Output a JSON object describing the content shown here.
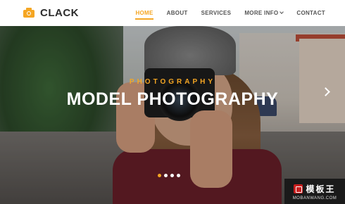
{
  "header": {
    "logo_text": "CLACK",
    "logo_icon": "camera-icon",
    "accent_color": "#f5a623",
    "nav": [
      {
        "label": "HOME",
        "active": true
      },
      {
        "label": "ABOUT",
        "active": false
      },
      {
        "label": "SERVICES",
        "active": false
      },
      {
        "label": "MORE INFO",
        "active": false,
        "has_dropdown": true
      },
      {
        "label": "CONTACT",
        "active": false
      }
    ]
  },
  "hero": {
    "subtitle": "PHOTOGRAPHY",
    "title": "MODEL PHOTOGRAPHY",
    "next_icon": "chevron-right-icon",
    "slides_total": 4,
    "active_slide": 1
  },
  "watermark": {
    "cn_text": "模板王",
    "en_text": "MOBANWANG.COM"
  }
}
